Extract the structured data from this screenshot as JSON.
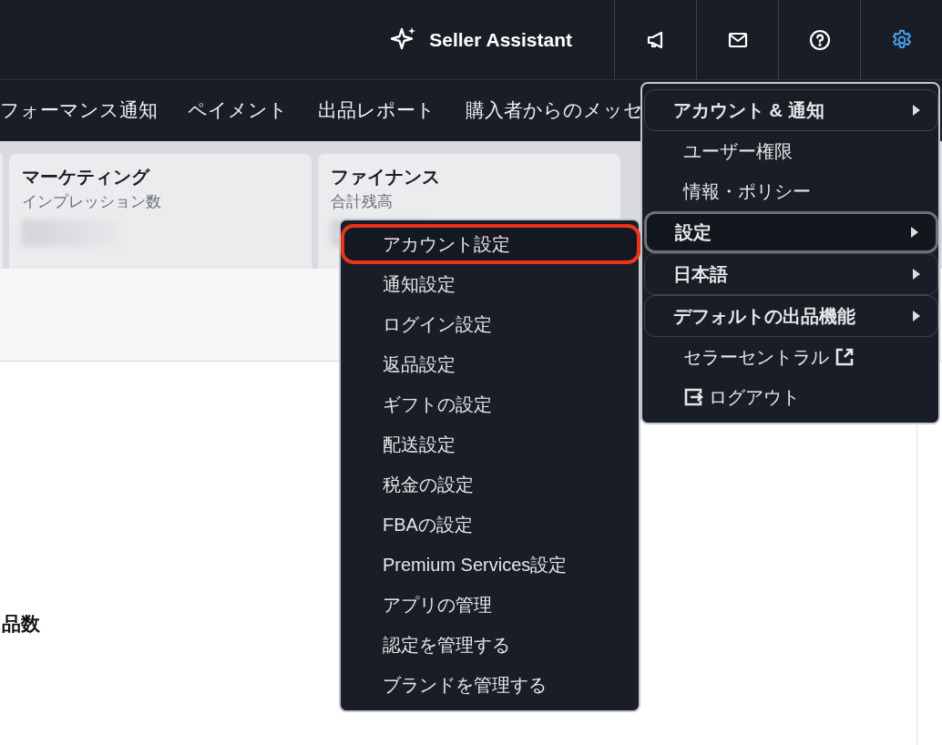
{
  "top_bar": {
    "assistant": "Seller Assistant",
    "icon_buttons": [
      {
        "kind": "megaphone",
        "selected": false
      },
      {
        "kind": "mail",
        "selected": false
      },
      {
        "kind": "help",
        "selected": false
      },
      {
        "kind": "settings",
        "selected": true
      }
    ]
  },
  "nav": [
    "フォーマンス通知",
    "ペイメント",
    "出品レポート",
    "購入者からのメッセ"
  ],
  "cards": [
    {
      "title": "マーケティング",
      "subtitle": "インプレッション数"
    },
    {
      "title": "ファイナンス",
      "subtitle": "合計残高"
    }
  ],
  "section_title": "品数",
  "menu": {
    "items": [
      {
        "kind": "group",
        "label": "アカウント & 通知",
        "selected": false
      },
      {
        "kind": "item",
        "label": "ユーザー権限"
      },
      {
        "kind": "item",
        "label": "情報・ポリシー"
      },
      {
        "kind": "group",
        "label": "設定",
        "selected": true
      },
      {
        "kind": "group",
        "label": "日本語",
        "selected": false
      },
      {
        "kind": "group",
        "label": "デフォルトの出品機能",
        "selected": false
      },
      {
        "kind": "external",
        "label": "セラーセントラル"
      },
      {
        "kind": "logout",
        "label": "ログアウト"
      }
    ]
  },
  "submenu": {
    "items": [
      {
        "label": "アカウント設定",
        "selected": true
      },
      {
        "label": "通知設定",
        "selected": false
      },
      {
        "label": "ログイン設定",
        "selected": false
      },
      {
        "label": "返品設定",
        "selected": false
      },
      {
        "label": "ギフトの設定",
        "selected": false
      },
      {
        "label": "配送設定",
        "selected": false
      },
      {
        "label": "税金の設定",
        "selected": false
      },
      {
        "label": "FBAの設定",
        "selected": false
      },
      {
        "label": "Premium Services設定",
        "selected": false
      },
      {
        "label": "アプリの管理",
        "selected": false
      },
      {
        "label": "認定を管理する",
        "selected": false
      },
      {
        "label": "ブランドを管理する",
        "selected": false
      }
    ]
  }
}
